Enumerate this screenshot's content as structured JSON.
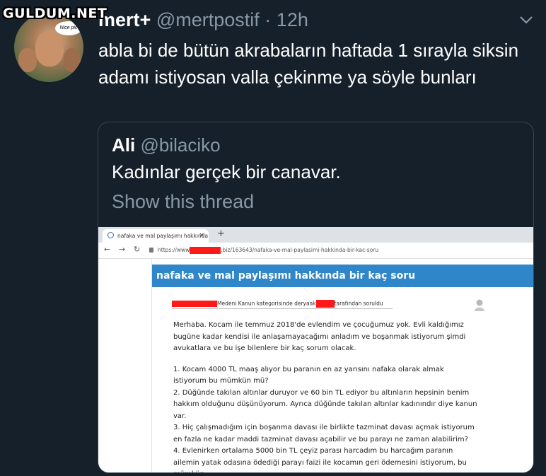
{
  "watermark": "GULDUM.NET",
  "tweet": {
    "display_name": "mert+",
    "handle": "@mertpostif",
    "separator": "·",
    "time": "12h",
    "avatar_bubble": "Nice pic",
    "text": "abla bi de bütün akrabaların haftada 1 sırayla siksin adamı istiyosan valla çekinme ya söyle bunları"
  },
  "quote": {
    "display_name": "Ali",
    "handle": "@bilaciko",
    "text": "Kadınlar gerçek bir canavar.",
    "show_thread": "Show this thread"
  },
  "screenshot": {
    "tab_title": "nafaka ve mal paylaşımı hakkında",
    "tab_close": "×",
    "new_tab": "+",
    "url_prefix": "https://www",
    "url_suffix": ".biz/163643/nafaka-ve-mal-paylasimi-hakkinda-bir-kac-soru",
    "page_title": "nafaka ve mal paylaşımı hakkında bir kaç soru",
    "meta_mid": "Medeni Kanun kategorisinde deryaak",
    "meta_end": "tarafından soruldu",
    "paragraphs": [
      "Merhaba. Kocam ile temmuz 2018'de evlendim ve çocuğumuz yok. Evli kaldığımız bugüne kadar kendisi ile anlaşamayacağımı anladım ve boşanmak istiyorum şimdi avukatlara ve bu işe bilenlere bir kaç sorum olacak.",
      "1. Kocam 4000 TL maaş alıyor bu paranın en az yarısını nafaka olarak almak istiyorum bu mümkün mü?\n2. Düğünde takılan altınlar duruyor ve 60 bin TL ediyor bu altınların hepsinin benim hakkım olduğunu düşünüyorum. Ayrıca düğünde takılan altınlar kadınındır diye kanun var.\n3. Hiç çalışmadığım için boşanma davası ile birlikte tazminat davası açmak istiyorum en fazla ne kadar maddi tazminat davası açabilir ve bu parayı ne zaman alabilirim?\n4. Evlenirken ortalama 5000 bin TL çeyiz parası harcadım bu harcağım paranın ailemin yatak odasına ödediği parayı faizi ile kocamın geri ödemesini istiyorum, bu mümkün"
    ]
  }
}
